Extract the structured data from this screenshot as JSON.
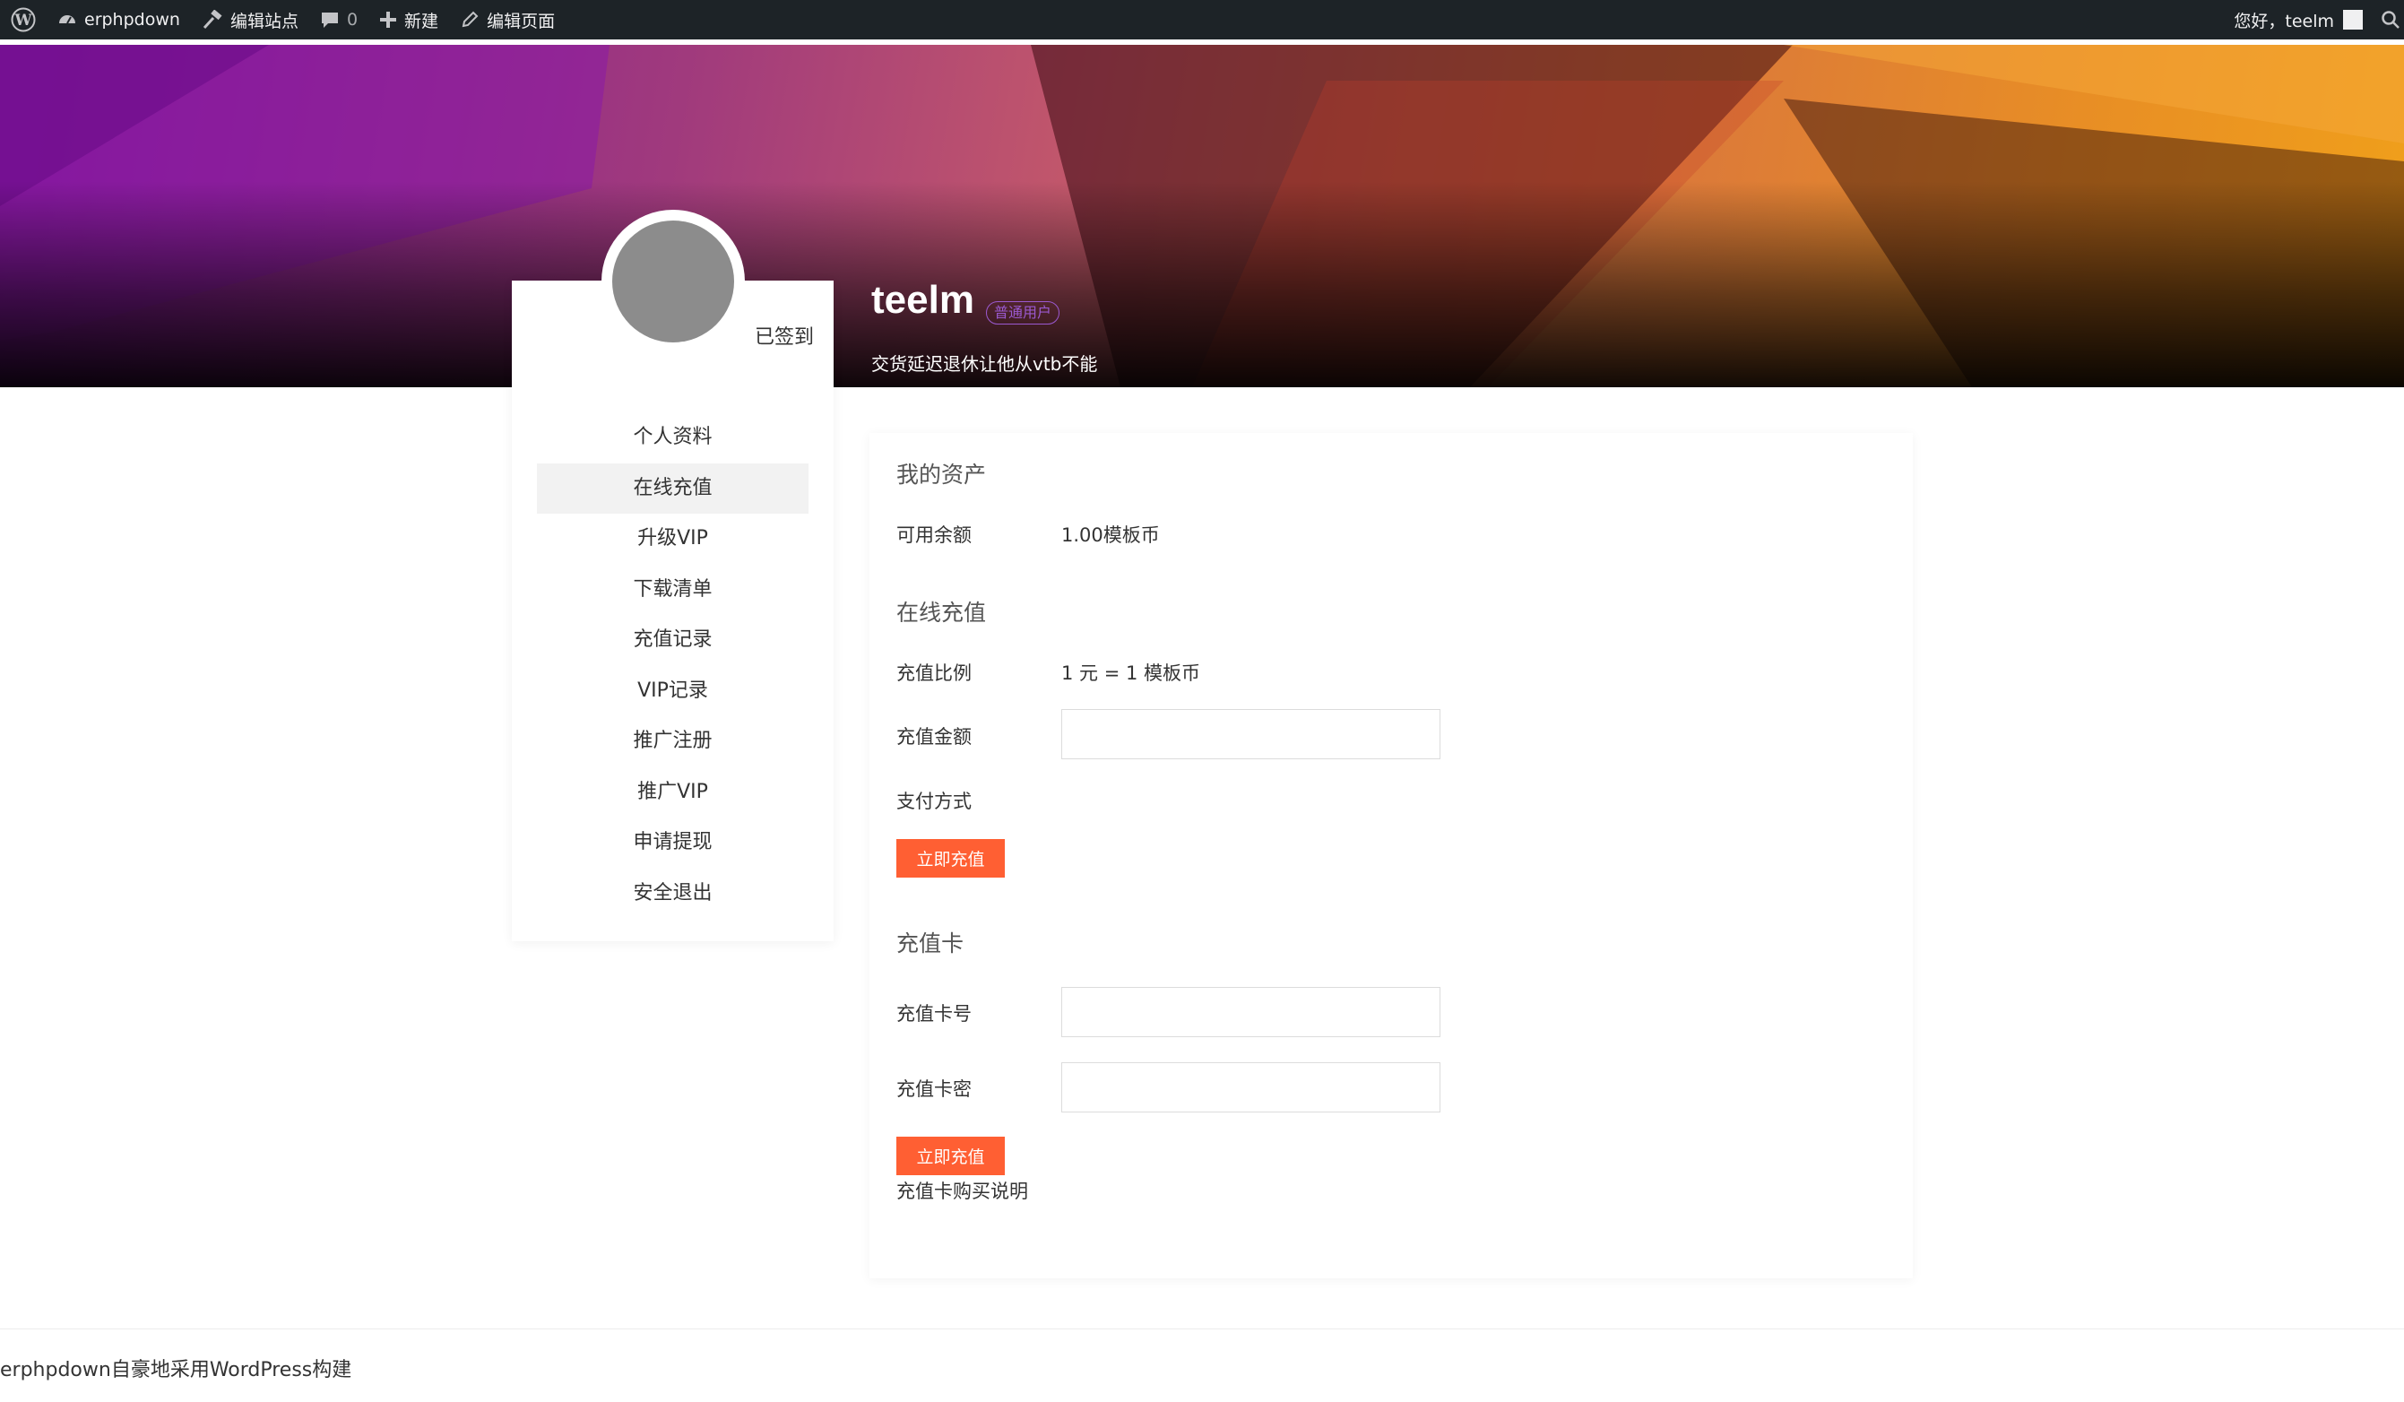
{
  "admin_bar": {
    "site_name": "erphpdown",
    "edit_site": "编辑站点",
    "comments_count": "0",
    "new_label": "新建",
    "edit_page": "编辑页面",
    "greeting": "您好，teelm"
  },
  "profile": {
    "username": "teelm",
    "badge": "普通用户",
    "bio": "交货延迟退休让他从vtb不能",
    "signed_status": "已签到"
  },
  "sidebar": {
    "items": [
      {
        "label": "个人资料"
      },
      {
        "label": "在线充值",
        "active": true
      },
      {
        "label": "升级VIP"
      },
      {
        "label": "下载清单"
      },
      {
        "label": "充值记录"
      },
      {
        "label": "VIP记录"
      },
      {
        "label": "推广注册"
      },
      {
        "label": "推广VIP"
      },
      {
        "label": "申请提现"
      },
      {
        "label": "安全退出"
      }
    ]
  },
  "assets": {
    "title": "我的资产",
    "balance_label": "可用余额",
    "balance_value": "1.00模板币"
  },
  "recharge": {
    "title": "在线充值",
    "ratio_label": "充值比例",
    "ratio_value": "1 元 = 1 模板币",
    "amount_label": "充值金额",
    "amount_value": "",
    "payment_label": "支付方式",
    "submit_label": "立即充值"
  },
  "card": {
    "title": "充值卡",
    "number_label": "充值卡号",
    "number_value": "",
    "password_label": "充值卡密",
    "password_value": "",
    "submit_label": "立即充值",
    "buy_link": "充值卡购买说明"
  },
  "footer": {
    "text": "erphpdown自豪地采用WordPress构建"
  },
  "colors": {
    "admin_bar_bg": "#1d2327",
    "accent_button": "#ff5f33",
    "badge": "#9b59d0",
    "avatar_placeholder": "#8c8c8c"
  }
}
